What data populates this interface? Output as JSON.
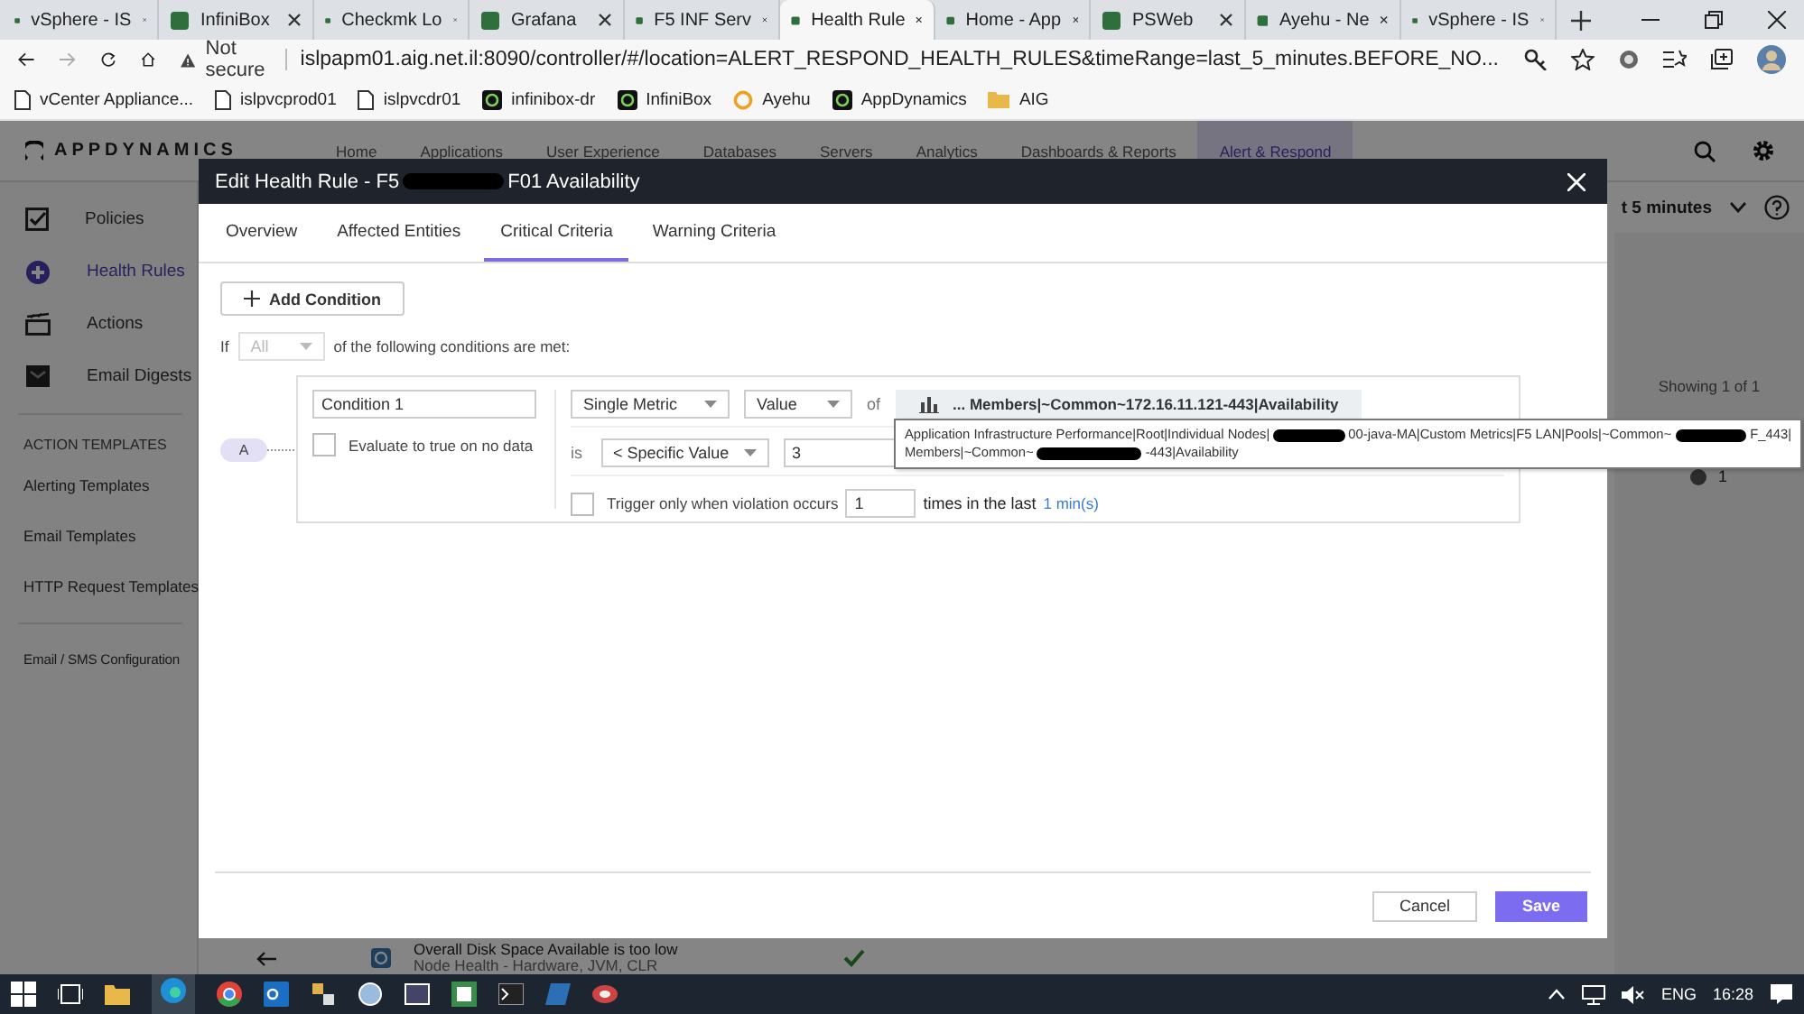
{
  "browser": {
    "tabs": [
      {
        "title": "vSphere - IS",
        "selected": false
      },
      {
        "title": "InfiniBox",
        "selected": false
      },
      {
        "title": "Checkmk Lo",
        "selected": false
      },
      {
        "title": "Grafana",
        "selected": false
      },
      {
        "title": "F5 INF Serv",
        "selected": false
      },
      {
        "title": "Health Rule",
        "selected": true
      },
      {
        "title": "Home - App",
        "selected": false
      },
      {
        "title": "PSWeb",
        "selected": false
      },
      {
        "title": "Ayehu - Ne",
        "selected": false
      },
      {
        "title": "vSphere - IS",
        "selected": false
      }
    ],
    "address": {
      "security": "Not secure",
      "url": "islpapm01.aig.net.il:8090/controller/#/location=ALERT_RESPOND_HEALTH_RULES&timeRange=last_5_minutes.BEFORE_NO..."
    },
    "bookmarks": [
      {
        "label": "vCenter Appliance...",
        "kind": "page"
      },
      {
        "label": "islpvcprod01",
        "kind": "page"
      },
      {
        "label": "islpvcdr01",
        "kind": "page"
      },
      {
        "label": "infinibox-dr",
        "kind": "app"
      },
      {
        "label": "InfiniBox",
        "kind": "app"
      },
      {
        "label": "Ayehu",
        "kind": "ring"
      },
      {
        "label": "AppDynamics",
        "kind": "app"
      },
      {
        "label": "AIG",
        "kind": "folder"
      }
    ]
  },
  "app": {
    "logo": "APPDYNAMICS",
    "nav": [
      {
        "label": "Home",
        "selected": false
      },
      {
        "label": "Applications",
        "selected": false
      },
      {
        "label": "User Experience",
        "selected": false
      },
      {
        "label": "Databases",
        "selected": false
      },
      {
        "label": "Servers",
        "selected": false
      },
      {
        "label": "Analytics",
        "selected": false
      },
      {
        "label": "Dashboards & Reports",
        "selected": false
      },
      {
        "label": "Alert & Respond",
        "selected": true
      }
    ],
    "sidebar": [
      {
        "label": "Policies",
        "kind": "main",
        "selected": false
      },
      {
        "label": "Health Rules",
        "kind": "main",
        "selected": true
      },
      {
        "label": "Actions",
        "kind": "main",
        "selected": false
      },
      {
        "label": "Email Digests",
        "kind": "main",
        "selected": false
      },
      {
        "label": "ACTION TEMPLATES",
        "kind": "heading"
      },
      {
        "label": "Alerting Templates",
        "kind": "link"
      },
      {
        "label": "Email Templates",
        "kind": "link"
      },
      {
        "label": "HTTP Request Templates",
        "kind": "link"
      },
      {
        "label": "Email / SMS Configuration",
        "kind": "link",
        "divider": true
      }
    ],
    "time_range": "t 5 minutes",
    "showing": "Showing 1 of 1",
    "count": "1",
    "list_row": {
      "title": "Overall Disk Space Available is too low",
      "subtitle": "Node Health - Hardware, JVM, CLR"
    }
  },
  "modal": {
    "title": [
      {
        "kind": "text",
        "text": "Edit Health Rule - F5"
      },
      {
        "kind": "redacted"
      },
      {
        "kind": "text",
        "text": "F01 Availability"
      }
    ],
    "tabs": [
      {
        "label": "Overview",
        "selected": false
      },
      {
        "label": "Affected Entities",
        "selected": false
      },
      {
        "label": "Critical Criteria",
        "selected": true
      },
      {
        "label": "Warning Criteria",
        "selected": false
      }
    ],
    "add_condition": "Add Condition",
    "match": {
      "prefix": "If",
      "value": "All",
      "disabled": true,
      "suffix": "of the following conditions are met:"
    },
    "condition": {
      "badge": "A",
      "name": "Condition 1",
      "no_data": {
        "label": "Evaluate to true on no data",
        "checked": false
      },
      "metric_type": "Single Metric",
      "value_type": "Value",
      "of": "of",
      "metric": "... Members|~Common~172.16.11.121-443|Availability",
      "is": "is",
      "operator": "< Specific Value",
      "threshold": "3",
      "trigger": {
        "label": "Trigger only when violation occurs",
        "checked": false,
        "count": "1",
        "middle": "times in the last",
        "period": "1 min(s)"
      }
    },
    "tooltip": [
      [
        {
          "kind": "text",
          "text": "Application Infrastructure Performance|Root|Individual Nodes|"
        },
        {
          "kind": "redacted"
        },
        {
          "kind": "text",
          "text": "00-java-MA|Custom Metrics|F5 LAN|Pools|~Common~"
        },
        {
          "kind": "redacted"
        },
        {
          "kind": "text",
          "text": "F_443|"
        }
      ],
      [
        {
          "kind": "text",
          "text": "Members|~Common~"
        },
        {
          "kind": "redacted"
        },
        {
          "kind": "text",
          "text": "-443|Availability"
        }
      ]
    ],
    "cancel": "Cancel",
    "save": "Save"
  },
  "taskbar": {
    "language": "ENG",
    "time": "16:28"
  }
}
